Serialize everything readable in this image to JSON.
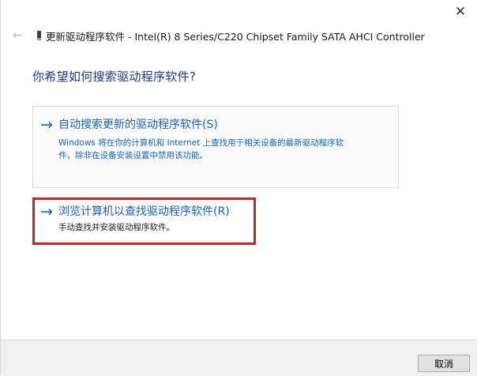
{
  "window": {
    "close_glyph": "✕",
    "header": {
      "back_glyph": "←",
      "title": "更新驱动程序软件 - Intel(R) 8 Series/C220 Chipset Family SATA AHCI Controller"
    }
  },
  "main": {
    "question": "你希望如何搜索驱动程序软件?",
    "options": [
      {
        "arrow": "→",
        "title": "自动搜索更新的驱动程序软件(S)",
        "description_line1": "Windows 将在你的计算机和 Internet 上查找用于相关设备的最新驱动程序软",
        "description_line2": "件，除非在设备安装设置中禁用该功能。"
      },
      {
        "arrow": "→",
        "title": "浏览计算机以查找驱动程序软件(R)",
        "description": "手动查找并安装驱动程序软件。"
      }
    ]
  },
  "footer": {
    "cancel_label": "取消"
  },
  "colors": {
    "link_blue": "#1565c0",
    "heading_blue": "#1e3a8a",
    "highlight_red": "#c62828",
    "footer_bg": "#f0f0f0"
  }
}
